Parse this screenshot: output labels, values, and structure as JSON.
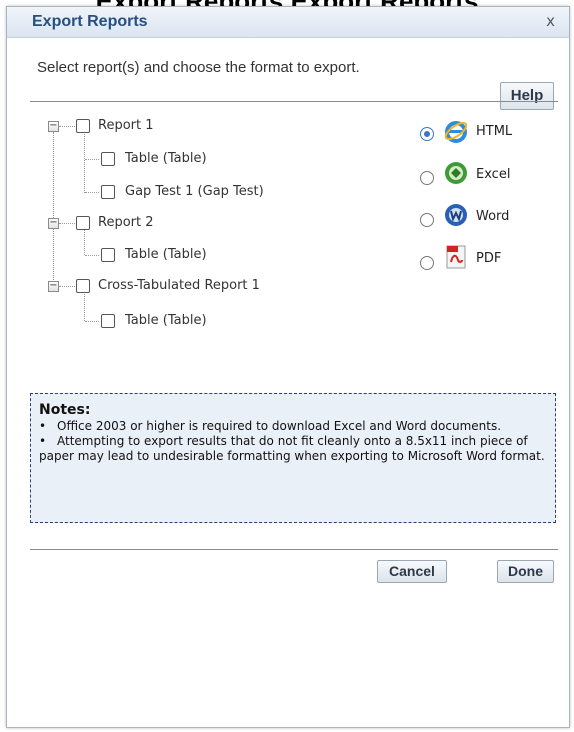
{
  "background": {
    "title": "Export Reports Export Reports"
  },
  "dialog": {
    "title": "Export Reports",
    "close_label": "x",
    "instruction": "Select report(s) and choose the format to export.",
    "help_label": "Help"
  },
  "tree": {
    "reports": [
      {
        "label": "Report 1",
        "checked": false,
        "children": [
          {
            "label": "Table (Table)",
            "checked": false
          },
          {
            "label": "Gap Test 1 (Gap Test)",
            "checked": false
          }
        ]
      },
      {
        "label": "Report 2",
        "checked": false,
        "children": [
          {
            "label": "Table (Table)",
            "checked": false
          }
        ]
      },
      {
        "label": "Cross-Tabulated Report 1",
        "checked": false,
        "children": [
          {
            "label": "Table (Table)",
            "checked": false
          }
        ]
      }
    ]
  },
  "formats": {
    "selected": "HTML",
    "options": [
      {
        "label": "HTML",
        "icon": "internet-explorer-icon"
      },
      {
        "label": "Excel",
        "icon": "excel-icon"
      },
      {
        "label": "Word",
        "icon": "word-icon"
      },
      {
        "label": "PDF",
        "icon": "pdf-icon"
      }
    ]
  },
  "notes": {
    "title": "Notes:",
    "items": [
      "Office 2003 or higher is required to download Excel and Word documents.",
      "Attempting to export results that do not fit cleanly onto a 8.5x11 inch piece of paper may lead to undesirable formatting when exporting to Microsoft Word format."
    ]
  },
  "footer": {
    "cancel_label": "Cancel",
    "done_label": "Done"
  },
  "colors": {
    "title": "#274f80",
    "notes_bg": "#eaf0f8",
    "notes_border": "#2b3f6b",
    "radio_accent": "#3b73c8"
  }
}
